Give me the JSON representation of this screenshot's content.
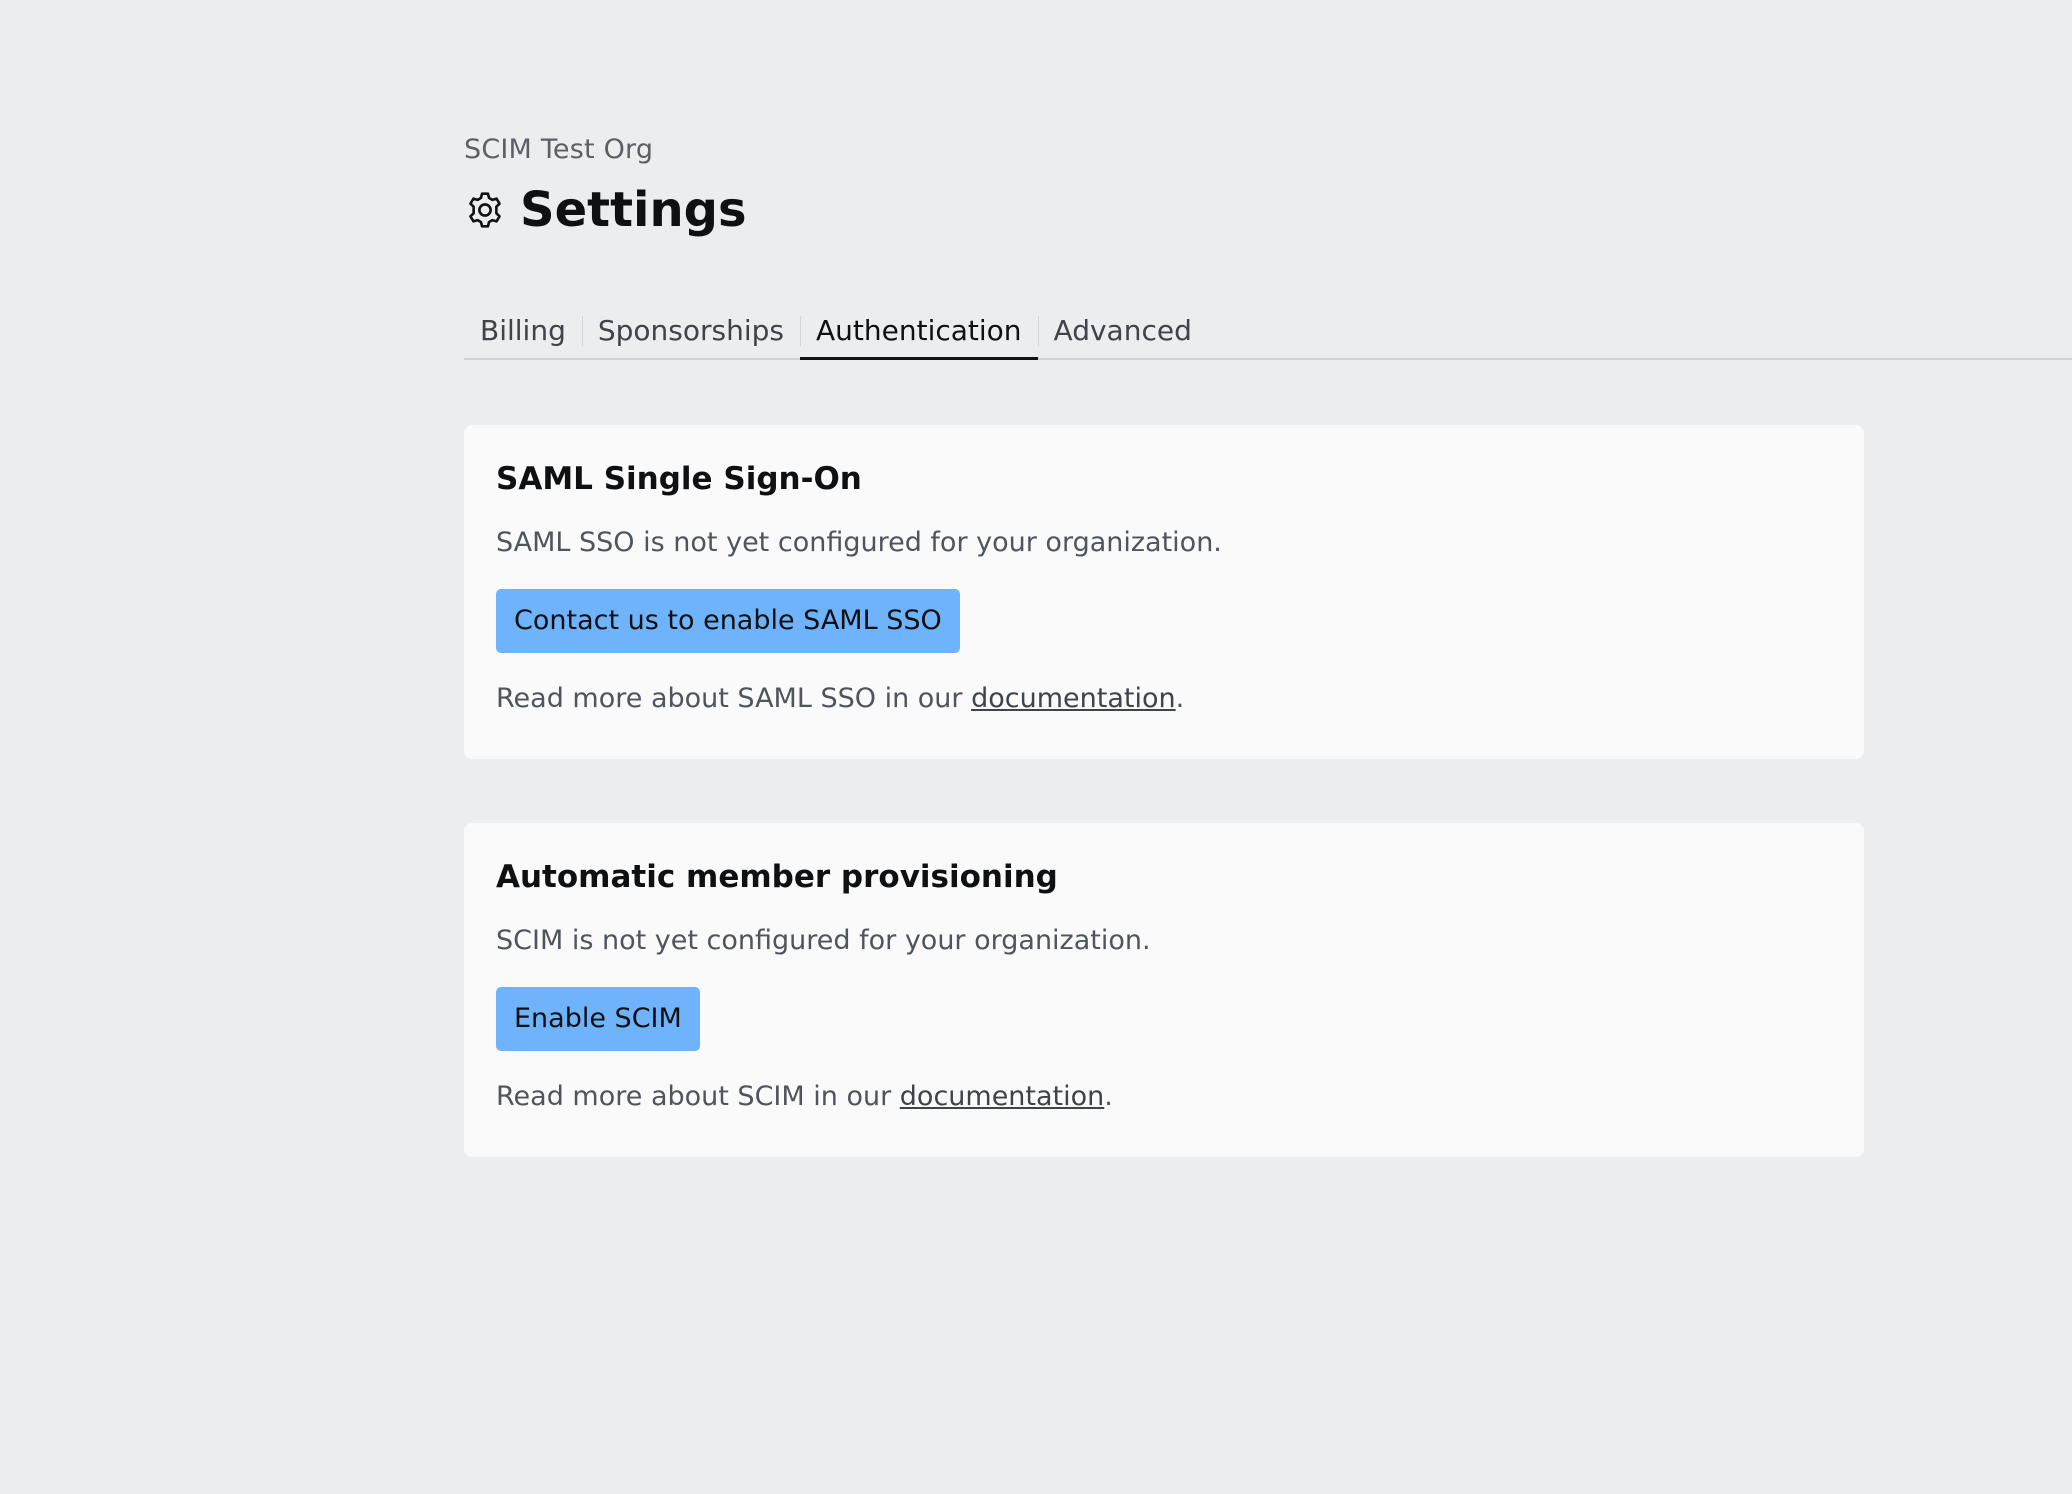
{
  "header": {
    "org_name": "SCIM Test Org",
    "title": "Settings",
    "icon": "gear-icon"
  },
  "tabs": [
    {
      "label": "Billing",
      "active": false
    },
    {
      "label": "Sponsorships",
      "active": false
    },
    {
      "label": "Authentication",
      "active": true
    },
    {
      "label": "Advanced",
      "active": false
    }
  ],
  "saml": {
    "title": "SAML Single Sign-On",
    "description": "SAML SSO is not yet configured for your organization.",
    "button_label": "Contact us to enable SAML SSO",
    "footer_prefix": "Read more about SAML SSO in our ",
    "footer_link": "documentation",
    "footer_suffix": "."
  },
  "scim": {
    "title": "Automatic member provisioning",
    "description": "SCIM is not yet configured for your organization.",
    "button_label": "Enable SCIM",
    "footer_prefix": "Read more about SCIM in our ",
    "footer_link": "documentation",
    "footer_suffix": "."
  },
  "colors": {
    "background": "#ECEDEF",
    "card": "#FAFAFA",
    "button": "#6EB3FB"
  }
}
